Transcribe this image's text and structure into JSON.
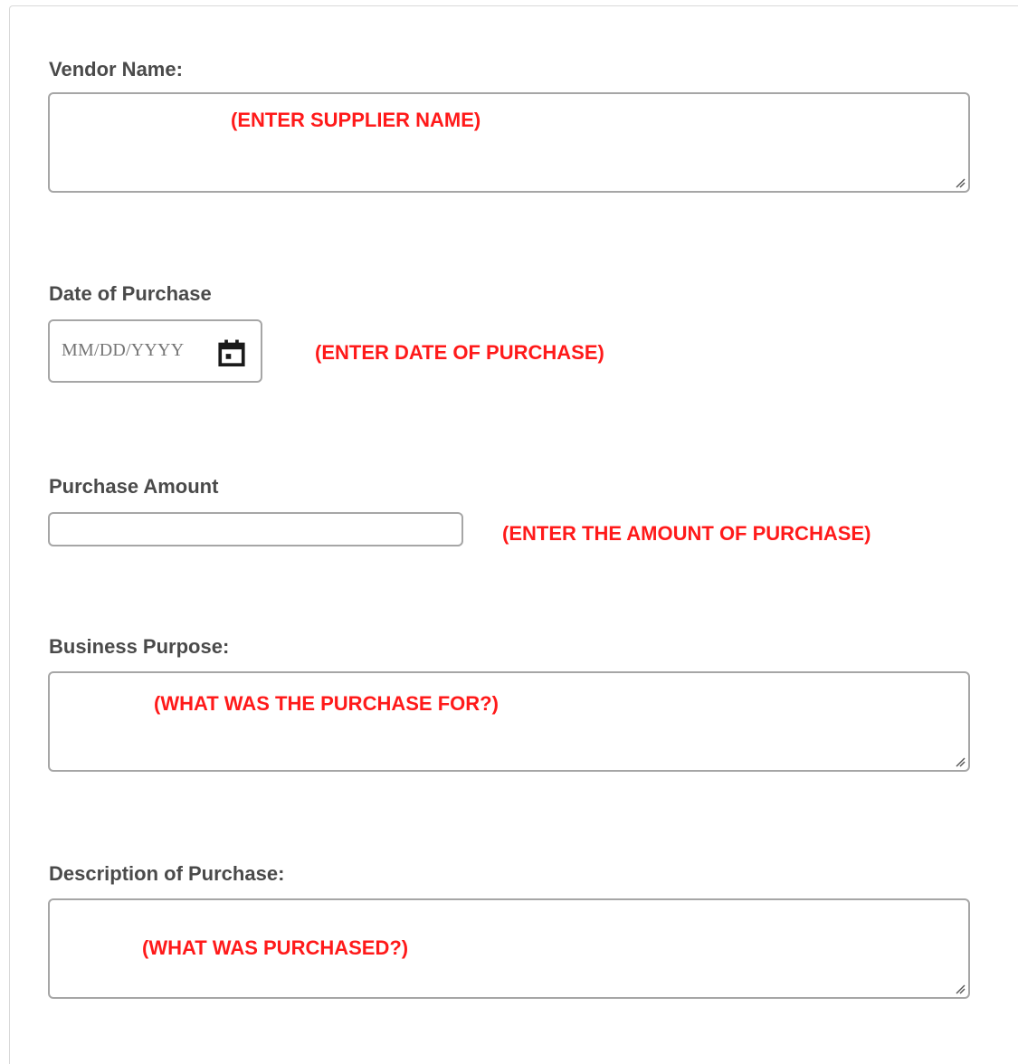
{
  "form": {
    "vendor": {
      "label": "Vendor Name:",
      "note": "(ENTER SUPPLIER NAME)"
    },
    "date": {
      "label": "Date of Purchase",
      "placeholder": "MM/DD/YYYY",
      "icon": "calendar-icon",
      "note": "(ENTER DATE OF PURCHASE)"
    },
    "amount": {
      "label": "Purchase Amount",
      "value": "",
      "note": "(ENTER THE AMOUNT OF PURCHASE)"
    },
    "purpose": {
      "label": "Business Purpose:",
      "note": "(WHAT WAS THE PURCHASE FOR?)"
    },
    "description": {
      "label": "Description of Purchase:",
      "note": "(WHAT WAS PURCHASED?)"
    }
  },
  "colors": {
    "label_text": "#4a4a4a",
    "annotation_red": "#ff1a1a",
    "field_border": "#a6a6a6"
  }
}
